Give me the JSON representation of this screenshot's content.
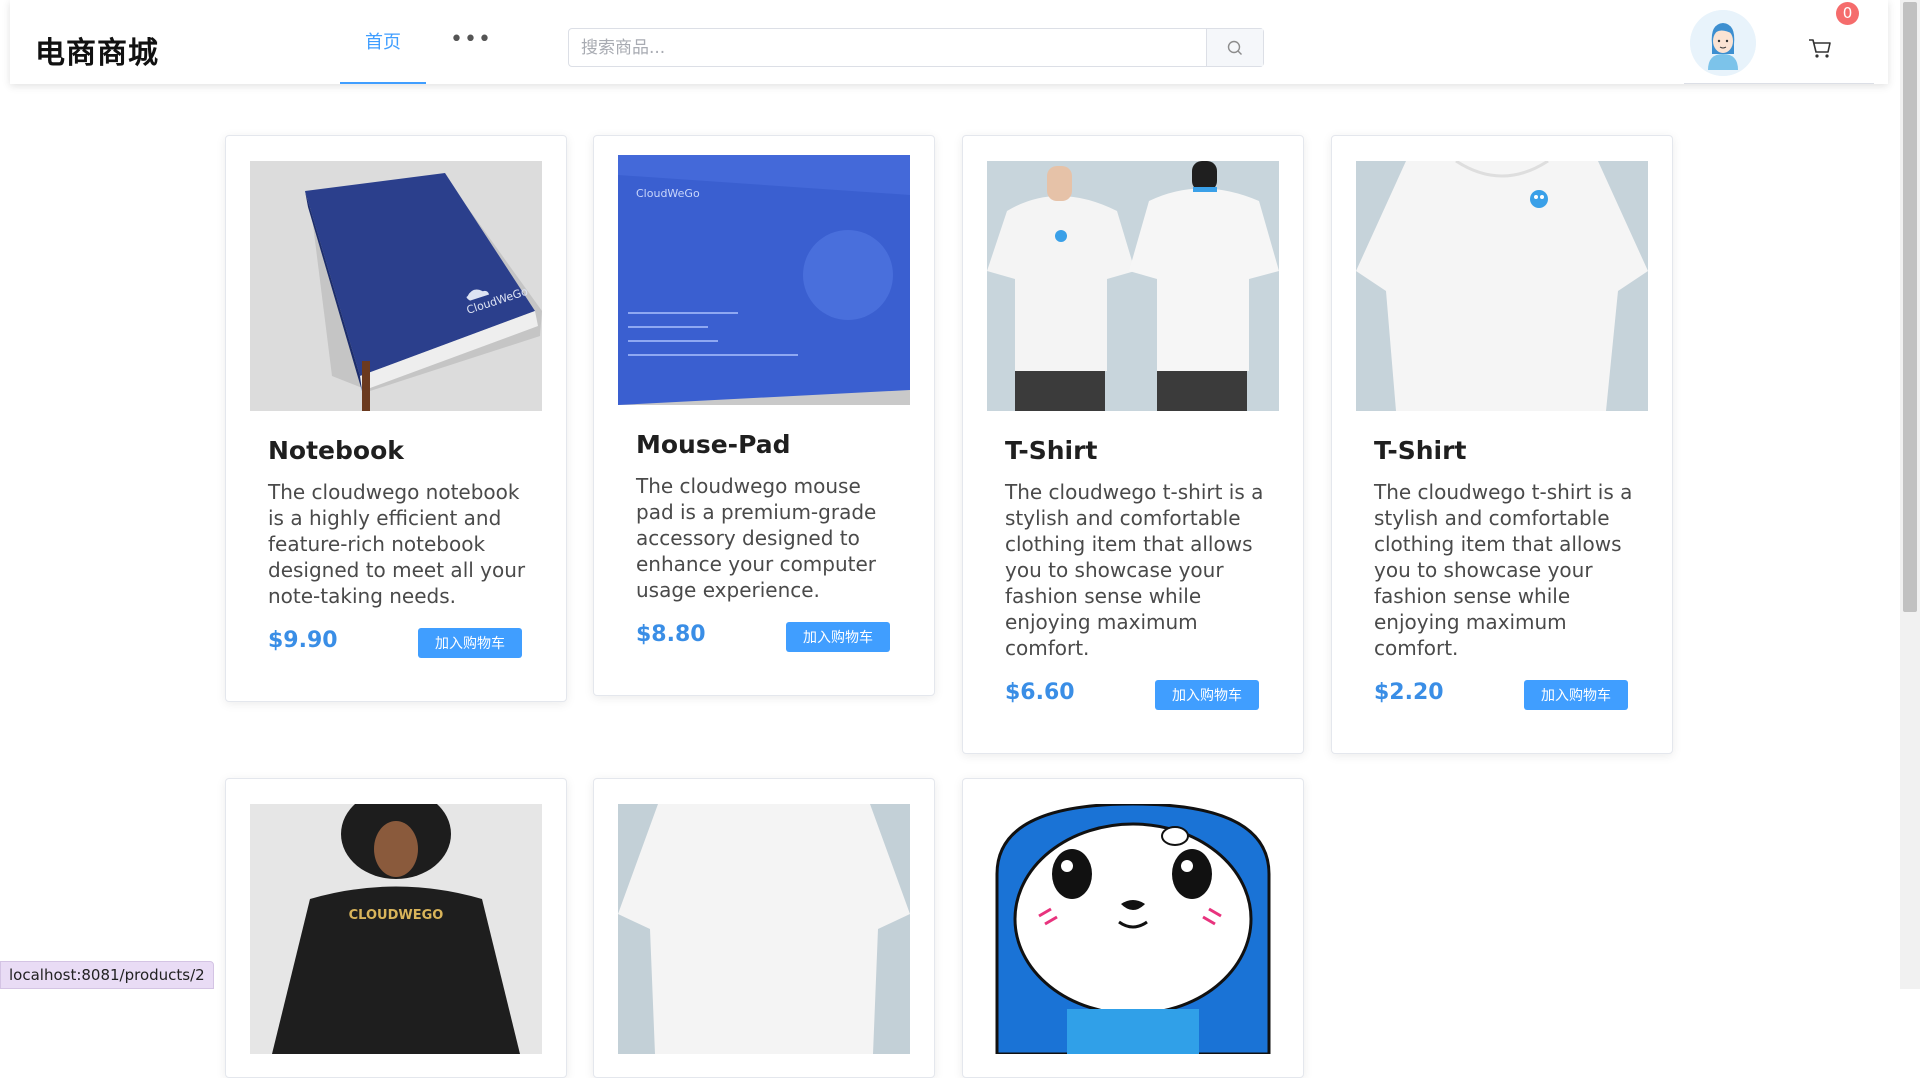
{
  "header": {
    "brand": "电商商城",
    "nav_home": "首页",
    "nav_more": "•••",
    "search_placeholder": "搜索商品...",
    "cart_count": "0"
  },
  "products": [
    {
      "title": "Notebook",
      "desc": "The cloudwego notebook is a highly efficient and feature-rich notebook designed to meet all your note-taking needs.",
      "price": "$9.90",
      "button": "加入购物车",
      "image_text": "CloudWeGo"
    },
    {
      "title": "Mouse-Pad",
      "desc": "The cloudwego mouse pad is a premium-grade accessory designed to enhance your computer usage experience.",
      "price": "$8.80",
      "button": "加入购物车",
      "image_text": "CloudWeGo"
    },
    {
      "title": "T-Shirt",
      "desc": "The cloudwego t-shirt is a stylish and comfortable clothing item that allows you to showcase your fashion sense while enjoying maximum comfort.",
      "price": "$6.60",
      "button": "加入购物车"
    },
    {
      "title": "T-Shirt",
      "desc": "The cloudwego t-shirt is a stylish and comfortable clothing item that allows you to showcase your fashion sense while enjoying maximum comfort.",
      "price": "$2.20",
      "button": "加入购物车"
    },
    {
      "image_text": "CLOUDWEGO"
    },
    {},
    {}
  ],
  "status_bar": "localhost:8081/products/2",
  "colors": {
    "accent": "#409eff",
    "price": "#3a8ee6",
    "badge": "#f56c6c"
  }
}
